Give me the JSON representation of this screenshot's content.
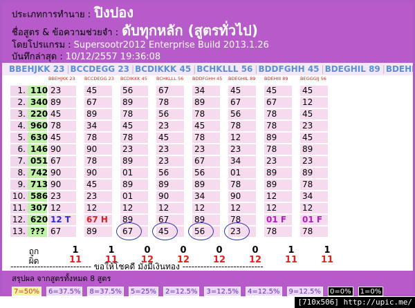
{
  "header": {
    "game_type_label": "ประเภทการทำนาย :",
    "game_type_value": "ปิงปอง",
    "formula_label": "ชื่อสูตร & ข้อความช่วยจำ :",
    "formula_value": "ดับทุกหลัก (สูตรทั่วไป)",
    "program_label": "โดยโปรแกรม :",
    "program_value": "Supersootr2012 Enterprise Build 2013.1.26",
    "saved_label": "บันทึกล่าสุด :",
    "saved_value": "10/12/2557 19:36:08"
  },
  "formula_bar": [
    "BBEHJKK 23",
    "BCCDEGG 23",
    "BCDIKKK 45",
    "BCHKLLL 56",
    "BDDFGHH 45",
    "BDEGHIL 89",
    "BDEHI"
  ],
  "columns": [
    {
      "code": "BBEHJKK 23"
    },
    {
      "code": "BCCDEGG 23"
    },
    {
      "code": "BCDIKKK 45"
    },
    {
      "code": "BCHKLLL 56"
    },
    {
      "code": "BDDFGHH 45"
    },
    {
      "code": "BDEGHIL 89"
    },
    {
      "code": "BDEHIII 89"
    },
    {
      "code": "BEGGGIJ 56"
    }
  ],
  "rows": [
    {
      "label": "1.",
      "num": "110",
      "vals": [
        "23",
        "45",
        "56",
        "67",
        "34",
        "45",
        "45",
        "45"
      ]
    },
    {
      "label": "2.",
      "num": "340",
      "vals": [
        "89",
        "67",
        "89",
        "78",
        "89",
        "67",
        "67",
        "12"
      ]
    },
    {
      "label": "3.",
      "num": "220",
      "vals": [
        "45",
        "89",
        "78",
        "56",
        "78",
        "56",
        "78",
        "45"
      ]
    },
    {
      "label": "4.",
      "num": "960",
      "vals": [
        "78",
        "34",
        "45",
        "23",
        "45",
        "78",
        "78",
        "23"
      ]
    },
    {
      "label": "5.",
      "num": "630",
      "vals": [
        "45",
        "78",
        "78",
        "45",
        "78",
        "12",
        "89",
        "45"
      ]
    },
    {
      "label": "6.",
      "num": "146",
      "vals": [
        "90",
        "90",
        "23",
        "23",
        "23",
        "23",
        "78",
        "89"
      ]
    },
    {
      "label": "7.",
      "num": "051",
      "vals": [
        "67",
        "78",
        "89",
        "23",
        "67",
        "34",
        "23",
        "23"
      ]
    },
    {
      "label": "8.",
      "num": "742",
      "vals": [
        "90",
        "90",
        "01",
        "56",
        "56",
        "01",
        "89",
        "89"
      ]
    },
    {
      "label": "9.",
      "num": "713",
      "vals": [
        "90",
        "45",
        "89",
        "89",
        "89",
        "78",
        "89",
        "78"
      ]
    },
    {
      "label": "10.",
      "num": "586",
      "vals": [
        "23",
        "23",
        "01",
        "90",
        "34",
        "90",
        "12",
        "34"
      ]
    },
    {
      "label": "11.",
      "num": "307",
      "vals": [
        "12",
        "12",
        "12",
        "12",
        "12",
        "12",
        "12",
        "12"
      ]
    },
    {
      "label": "12.",
      "num": "620",
      "vals": [
        "12 T",
        "67 H",
        "89",
        "67",
        "89",
        "78",
        "01 F",
        "01 F"
      ]
    },
    {
      "label": "13.",
      "num": "???",
      "vals": [
        "67",
        "89",
        "67",
        "45",
        "56",
        "23",
        "78",
        "78"
      ]
    }
  ],
  "totals": {
    "win_label": "ถูก",
    "loss_label": "ผิด",
    "wins": [
      "1",
      "1",
      "0",
      "0",
      "0",
      "0",
      "1",
      "1"
    ],
    "losses": [
      "11",
      "11",
      "12",
      "12",
      "12",
      "12",
      "11",
      "11"
    ]
  },
  "divider_text": "--------------------------- ขอให้โชคดี มั่งมีเงินทอง ---------------------------",
  "summary": {
    "title": "สรุปผล จากสูตรทั้งหมด 8 สูตร",
    "badges": [
      {
        "text": "7=50%",
        "bg": "#f7f3a8",
        "fg": "#c9421c"
      },
      {
        "text": "6=37.5%",
        "bg": "#e9d8f7",
        "fg": "#6a2bb3"
      },
      {
        "text": "8=37.5%",
        "bg": "#e9d8f7",
        "fg": "#6a2bb3"
      },
      {
        "text": "5=25%",
        "bg": "#e9d8f7",
        "fg": "#6a2bb3"
      },
      {
        "text": "2=12.5%",
        "bg": "#e9d8f7",
        "fg": "#6a2bb3"
      },
      {
        "text": "3=12.5%",
        "bg": "#e9d8f7",
        "fg": "#6a2bb3"
      },
      {
        "text": "4=12.5%",
        "bg": "#e9d8f7",
        "fg": "#6a2bb3"
      },
      {
        "text": "9=12.5%",
        "bg": "#e9d8f7",
        "fg": "#6a2bb3"
      },
      {
        "text": "0=0%",
        "bg": "#000000",
        "fg": "#ffffff"
      },
      {
        "text": "1=0%",
        "bg": "#000000",
        "fg": "#ffffff"
      }
    ]
  },
  "credit": "[710x506] http://upic.me/"
}
